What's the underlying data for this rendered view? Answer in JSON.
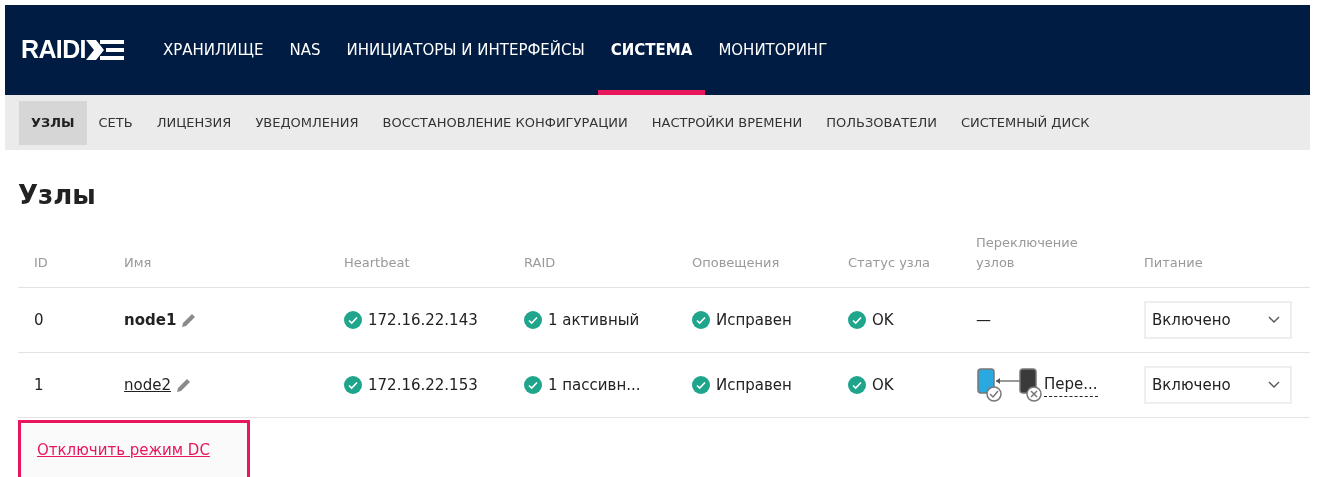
{
  "logo": {
    "text": "RAIDI"
  },
  "top_nav": [
    {
      "label": "ХРАНИЛИЩЕ",
      "selected": false
    },
    {
      "label": "NAS",
      "selected": false
    },
    {
      "label": "ИНИЦИАТОРЫ И ИНТЕРФЕЙСЫ",
      "selected": false
    },
    {
      "label": "СИСТЕМА",
      "selected": true
    },
    {
      "label": "МОНИТОРИНГ",
      "selected": false
    }
  ],
  "sub_nav": [
    {
      "label": "УЗЛЫ",
      "selected": true
    },
    {
      "label": "СЕТЬ",
      "selected": false
    },
    {
      "label": "ЛИЦЕНЗИЯ",
      "selected": false
    },
    {
      "label": "УВЕДОМЛЕНИЯ",
      "selected": false
    },
    {
      "label": "ВОССТАНОВЛЕНИЕ КОНФИГУРАЦИИ",
      "selected": false
    },
    {
      "label": "НАСТРОЙКИ ВРЕМЕНИ",
      "selected": false
    },
    {
      "label": "ПОЛЬЗОВАТЕЛИ",
      "selected": false
    },
    {
      "label": "СИСТЕМНЫЙ ДИСК",
      "selected": false
    }
  ],
  "page_title": "Узлы",
  "table": {
    "columns": [
      "ID",
      "Имя",
      "Heartbeat",
      "RAID",
      "Оповещения",
      "Статус узла",
      "Переключение узлов",
      "Питание"
    ],
    "rows": [
      {
        "id": "0",
        "name": "node1",
        "kind": "current",
        "heartbeat": "172.16.22.143",
        "raid": "1 активный",
        "alerts": "Исправен",
        "status": "OK",
        "switch": {
          "kind": "none",
          "text": "—"
        },
        "power": "Включено"
      },
      {
        "id": "1",
        "name": "node2",
        "kind": "link",
        "heartbeat": "172.16.22.153",
        "raid": "1 пассивн...",
        "alerts": "Исправен",
        "status": "OK",
        "switch": {
          "kind": "action",
          "text": "Пере..."
        },
        "power": "Включено"
      }
    ]
  },
  "dc_link": "Отключить режим DC"
}
